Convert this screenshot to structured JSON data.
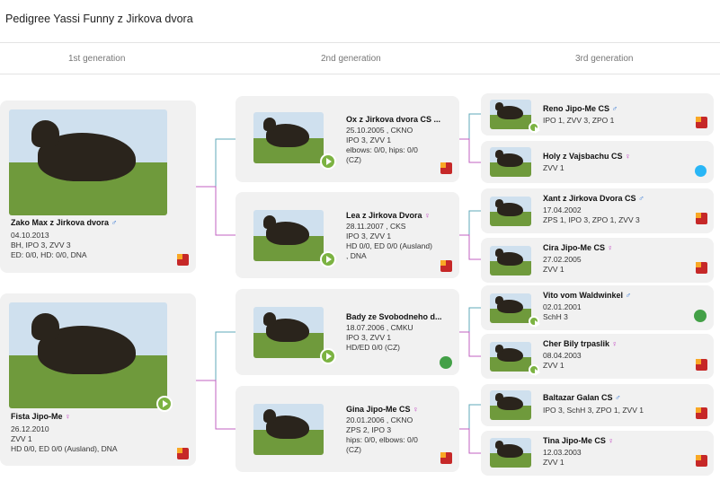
{
  "title": "Pedigree Yassi Funny z Jirkova dvora",
  "generations": [
    "1st generation",
    "2nd generation",
    "3rd generation"
  ],
  "gen1": [
    {
      "name": "Zako Max z Jirkova dvora",
      "sex": "♂",
      "date": "04.10.2013",
      "line2": "BH, IPO 3, ZVV 3",
      "line3": "ED: 0/0, HD: 0/0, DNA",
      "badge": "flag"
    },
    {
      "name": "Fista Jipo-Me",
      "sex": "♀",
      "date": "26.12.2010",
      "line2": "ZVV 1",
      "line3": "HD 0/0, ED 0/0 (Ausland), DNA",
      "badge": "flag"
    }
  ],
  "gen2": [
    {
      "name": "Ox z Jirkova dvora CS ...",
      "sex": "",
      "date": "25.10.2005 , CKNO",
      "line2": "IPO 3, ZVV 1",
      "line3": "elbows: 0/0, hips: 0/0",
      "line4": "(CZ)",
      "badge": "flag"
    },
    {
      "name": "Lea z Jirkova Dvora",
      "sex": "♀",
      "date": "28.11.2007 , CKS",
      "line2": "IPO 3, ZVV 1",
      "line3": "HD 0/0, ED 0/0 (Ausland)",
      "line4": ", DNA",
      "badge": "flag"
    },
    {
      "name": "Bady ze Svobodneho d...",
      "sex": "",
      "date": "18.07.2006 , CMKU",
      "line2": "IPO 3, ZVV 1",
      "line3": "HD/ED 0/0 (CZ)",
      "line4": "",
      "badge": "swirl"
    },
    {
      "name": "Gina Jipo-Me CS",
      "sex": "♀",
      "date": "20.01.2006 , CKNO",
      "line2": "ZPS 2, IPO 3",
      "line3": "hips: 0/0, elbows: 0/0",
      "line4": "(CZ)",
      "badge": "flag"
    }
  ],
  "gen3": [
    {
      "name": "Reno Jipo-Me CS",
      "sex": "♂",
      "line1": "IPO 1, ZVV 3, ZPO 1",
      "line2": "",
      "badge": "flag"
    },
    {
      "name": "Holy z Vajsbachu CS",
      "sex": "♀",
      "line1": "ZVV 1",
      "line2": "",
      "badge": "globe"
    },
    {
      "name": "Xant z Jirkova Dvora CS",
      "sex": "♂",
      "line1": "17.04.2002",
      "line2": "ZPS 1, IPO 3, ZPO 1, ZVV 3",
      "badge": "flag"
    },
    {
      "name": "Cira Jipo-Me CS",
      "sex": "♀",
      "line1": "27.02.2005",
      "line2": "ZVV 1",
      "badge": "flag"
    },
    {
      "name": "Vito vom Waldwinkel",
      "sex": "♂",
      "line1": "02.01.2001",
      "line2": "SchH 3",
      "badge": "swirl"
    },
    {
      "name": "Cher Bily trpaslik",
      "sex": "♀",
      "line1": "08.04.2003",
      "line2": "ZVV 1",
      "badge": "flag"
    },
    {
      "name": "Baltazar Galan CS",
      "sex": "♂",
      "line1": "IPO 3, SchH 3, ZPO 1, ZVV 1",
      "line2": "",
      "badge": "flag"
    },
    {
      "name": "Tina Jipo-Me CS",
      "sex": "♀",
      "line1": "12.03.2003",
      "line2": "ZVV 1",
      "badge": "flag"
    }
  ]
}
